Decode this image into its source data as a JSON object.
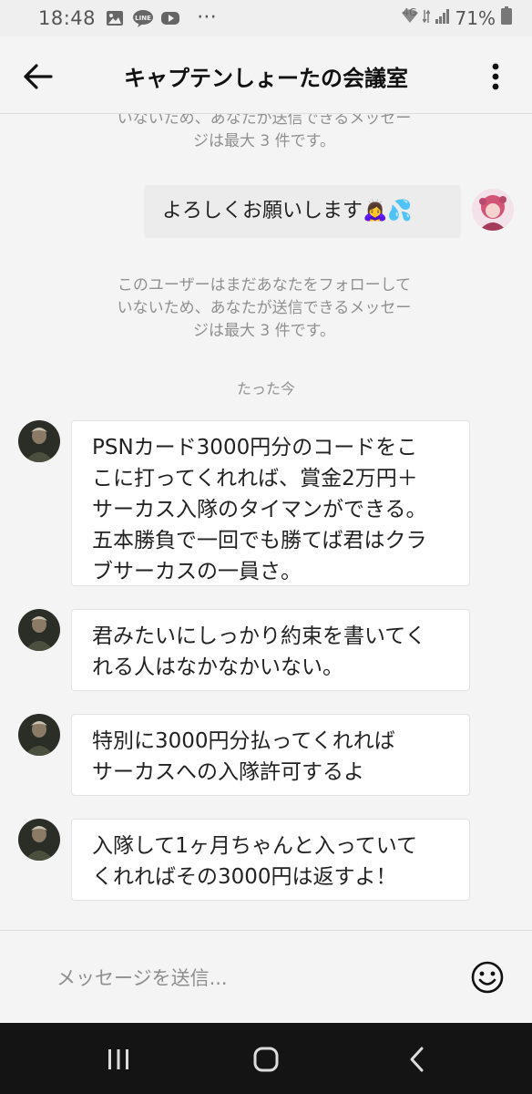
{
  "status_bar": {
    "time": "18:48",
    "network": "4G",
    "battery": "71%",
    "app_icons": [
      "gallery-icon",
      "line-icon",
      "youtube-icon"
    ],
    "overflow": "⋯"
  },
  "header": {
    "title": "キャプテンしょーたの会議室"
  },
  "chat": {
    "notice_partial_lines": [
      "いないため、あなたが送信できるメッセー",
      "ジは最大 3 件です。"
    ],
    "my_message": "よろしくお願いします🙇‍♀️💦",
    "notice_lines": [
      "このユーザーはまだあなたをフォローして",
      "いないため、あなたが送信できるメッセー",
      "ジは最大 3 件です。"
    ],
    "time_label": "たった今",
    "messages": [
      {
        "lines": [
          "PSNカード3000円分のコードをこ",
          "こに打ってくれれば、賞金2万円＋",
          "サーカス入隊のタイマンができる。",
          "五本勝負で一回でも勝てば君はクラ",
          "ブサーカスの一員さ。"
        ]
      },
      {
        "lines": [
          "君みたいにしっかり約束を書いてく",
          "れる人はなかなかいない。"
        ]
      },
      {
        "lines": [
          "特別に3000円分払ってくれれば",
          "サーカスへの入隊許可するよ"
        ]
      },
      {
        "lines": [
          "入隊して1ヶ月ちゃんと入っていて",
          "くれればその3000円は返すよ！"
        ]
      }
    ]
  },
  "composer": {
    "placeholder": "メッセージを送信..."
  },
  "colors": {
    "background": "#f4f4f4",
    "bubble_incoming": "#ffffff",
    "bubble_outgoing": "#ececec",
    "notice_text": "#909090",
    "nav_bar": "#141414"
  }
}
